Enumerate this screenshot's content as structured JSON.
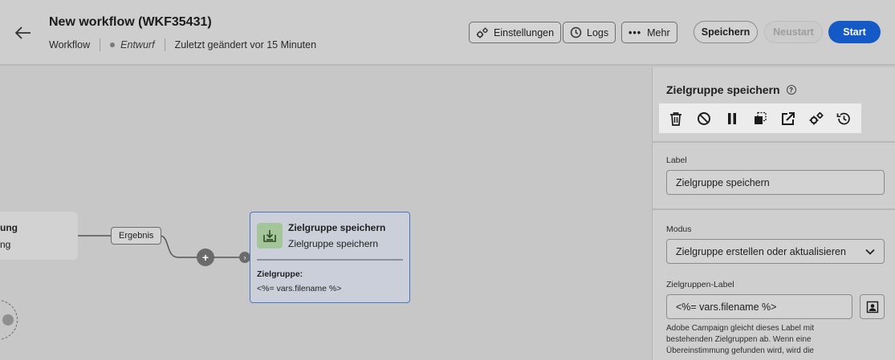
{
  "header": {
    "title": "New workflow (WKF35431)",
    "type": "Workflow",
    "status": "Entwurf",
    "modified": "Zuletzt geändert vor 15 Minuten",
    "buttons": {
      "settings": "Einstellungen",
      "logs": "Logs",
      "more": "Mehr",
      "save": "Speichern",
      "restart": "Neustart",
      "start": "Start"
    }
  },
  "canvas": {
    "prev_node": {
      "line1": "ung",
      "line2": "ng"
    },
    "transition_label": "Ergebnis",
    "node": {
      "title": "Zielgruppe speichern",
      "subtitle": "Zielgruppe speichern",
      "detail_label": "Zielgruppe:",
      "detail_value": "<%= vars.filename %>"
    }
  },
  "panel": {
    "title": "Zielgruppe speichern",
    "toolbar_icons": [
      "trash-icon",
      "disable-icon",
      "pause-icon",
      "copy-icon",
      "open-external-icon",
      "settings-icon",
      "history-icon"
    ],
    "label_field": {
      "label": "Label",
      "value": "Zielgruppe speichern"
    },
    "mode_field": {
      "label": "Modus",
      "value": "Zielgruppe erstellen oder aktualisieren"
    },
    "audience_label_field": {
      "label": "Zielgruppen-Label",
      "value": "<%= vars.filename %>"
    },
    "help_text": "Adobe Campaign gleicht dieses Label mit bestehenden Zielgruppen ab. Wenn eine Übereinstimmung gefunden wird, wird die"
  },
  "colors": {
    "accent": "#1559c7",
    "node_border": "#4b74c5",
    "node_icon_bg": "#a4c49a"
  }
}
